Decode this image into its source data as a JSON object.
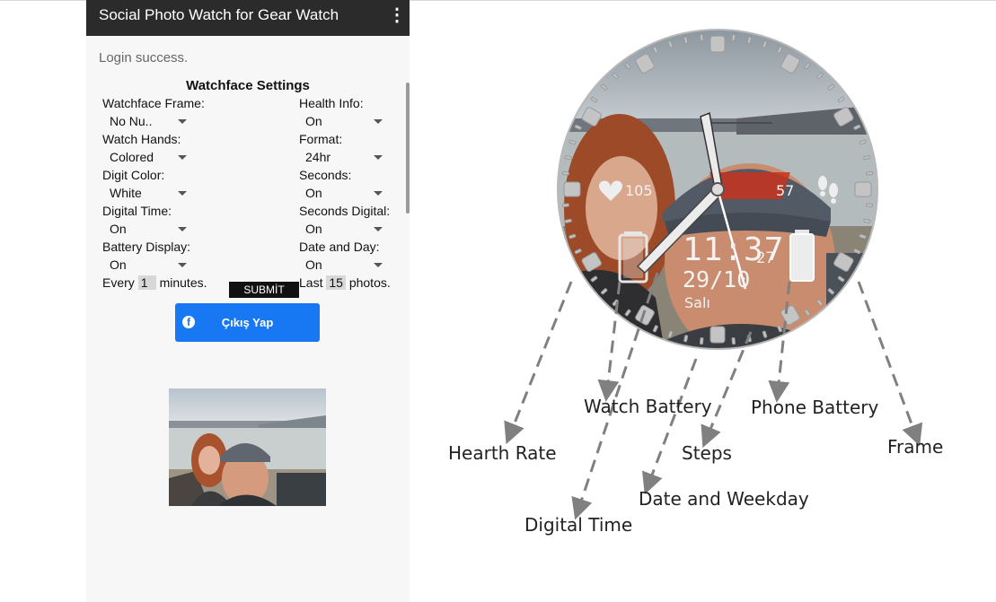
{
  "app": {
    "title": "Social Photo Watch for Gear Watch",
    "menu_icon": "more-vert-icon",
    "status": "Login success.",
    "settings_title": "Watchface Settings",
    "left_settings": [
      {
        "label": "Watchface Frame:",
        "value": "No Nu.."
      },
      {
        "label": "Watch Hands:",
        "value": "Colored"
      },
      {
        "label": "Digit Color:",
        "value": "White"
      },
      {
        "label": "Digital Time:",
        "value": "On"
      },
      {
        "label": "Battery Display:",
        "value": "On"
      }
    ],
    "right_settings": [
      {
        "label": "Health Info:",
        "value": "On"
      },
      {
        "label": "Format:",
        "value": "24hr"
      },
      {
        "label": "Seconds:",
        "value": "On"
      },
      {
        "label": "Seconds Digital:",
        "value": "On"
      },
      {
        "label": "Date and Day:",
        "value": "On"
      }
    ],
    "every_prefix": "Every",
    "every_value": "1",
    "every_suffix": "minutes.",
    "last_prefix": "Last",
    "last_value": "15",
    "last_suffix": "photos.",
    "submit_label": "SUBMİT",
    "facebook_label": "Çıkış Yap",
    "facebook_icon": "facebook-icon"
  },
  "watch": {
    "heart_rate": "105",
    "steps": "57",
    "time": "11:37",
    "seconds": "27",
    "date": "29/10",
    "weekday": "Salı"
  },
  "callouts": {
    "heart_rate": "Hearth Rate",
    "watch_battery": "Watch Battery",
    "digital_time": "Digital Time",
    "date_weekday": "Date and Weekday",
    "steps": "Steps",
    "phone_battery": "Phone Battery",
    "frame": "Frame"
  },
  "colors": {
    "appbar": "#2b2b2b",
    "facebook": "#1877f2",
    "arrow": "#808080"
  }
}
